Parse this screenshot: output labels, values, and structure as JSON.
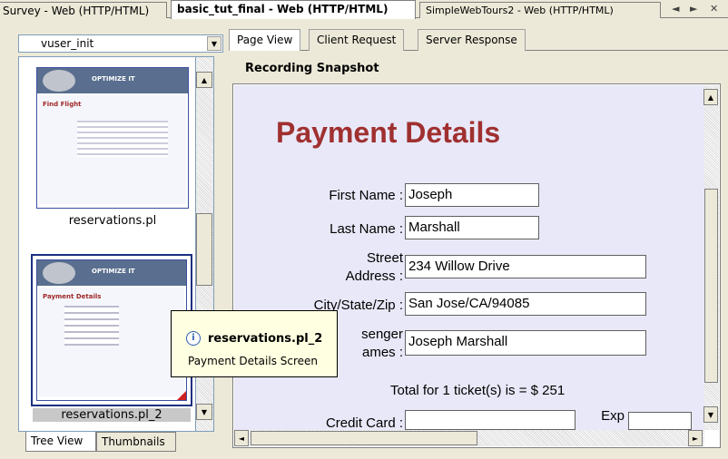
{
  "doc_tabs": [
    {
      "label": "Survey - Web (HTTP/HTML)"
    },
    {
      "label": "basic_tut_final - Web (HTTP/HTML)"
    },
    {
      "label": "SimpleWebTours2 - Web (HTTP/HTML)"
    }
  ],
  "tab_nav": {
    "prev": "◄",
    "next": "►",
    "close": "✕"
  },
  "left_panel": {
    "action_select": "vuser_init",
    "thumbnails": [
      {
        "logo": "OPTIMIZE IT",
        "title": "Find Flight",
        "label": "reservations.pl"
      },
      {
        "logo": "OPTIMIZE IT",
        "title": "Payment Details",
        "label": "reservations.pl_2"
      }
    ],
    "bottom_tabs": [
      "Tree View",
      "Thumbnails"
    ]
  },
  "tooltip": {
    "icon": "info-icon",
    "title": "reservations.pl_2",
    "description": "Payment Details Screen"
  },
  "view_tabs": [
    "Page View",
    "Client Request",
    "Server Response"
  ],
  "snapshot_label": "Recording Snapshot",
  "page": {
    "title": "Payment Details",
    "fields": {
      "first_name": {
        "label": "First Name :",
        "value": "Joseph"
      },
      "last_name": {
        "label": "Last Name :",
        "value": "Marshall"
      },
      "street_l1": "Street",
      "street_l2": "Address :",
      "street_value": "234 Willow Drive",
      "city": {
        "label": "City/State/Zip :",
        "value": "San Jose/CA/94085"
      },
      "passenger_l1": "senger",
      "passenger_l2": "ames :",
      "passenger_value": "Joseph Marshall",
      "credit_card": {
        "label": "Credit Card :",
        "value": ""
      },
      "exp": {
        "label": "Exp",
        "value": ""
      }
    },
    "total": "Total for 1 ticket(s) is = $ 251"
  },
  "colors": {
    "title_red": "#a03030",
    "page_bg": "#e8e8f8",
    "tooltip_bg": "#ffffe1"
  }
}
